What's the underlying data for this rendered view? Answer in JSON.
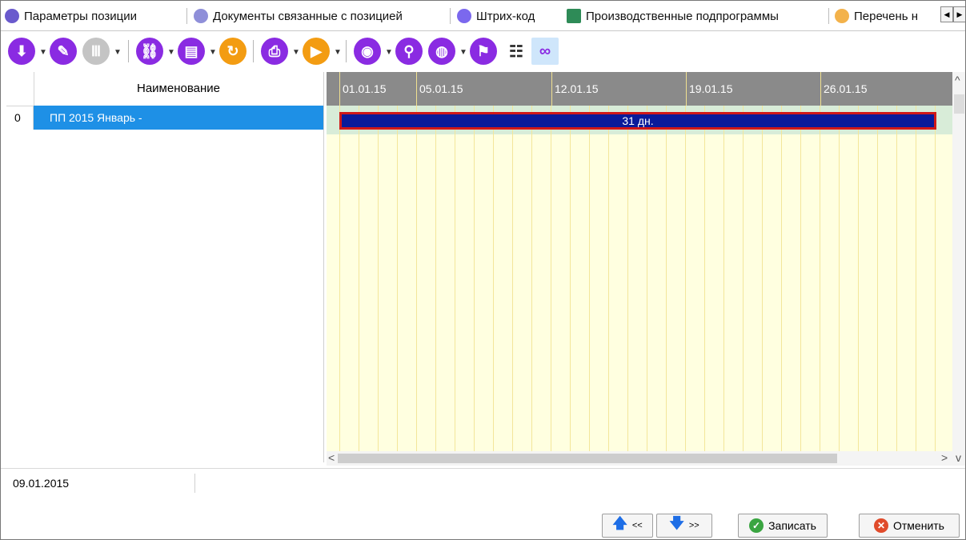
{
  "tabs": [
    {
      "label": "Параметры позиции",
      "icon": "parameters-icon",
      "color": "#6a5acd"
    },
    {
      "label": "Документы связанные с позицией",
      "icon": "documents-icon",
      "color": "#8f8fd9"
    },
    {
      "label": "Штрих-код",
      "icon": "barcode-icon",
      "color": "#7b68ee"
    },
    {
      "label": "Производственные подпрограммы",
      "icon": "grid-table-icon",
      "color": "#2e8b57",
      "active": true
    },
    {
      "label": "Перечень н",
      "icon": "list-icon",
      "color": "#f3b24b"
    }
  ],
  "toolbar": {
    "icons": [
      "download-icon",
      "edit-icon",
      "columns-icon",
      "link-icon",
      "document-icon",
      "refresh-icon",
      "print-icon",
      "play-icon",
      "eye-icon",
      "search-icon",
      "globe-icon",
      "flag-icon",
      "tree-icon",
      "glasses-icon"
    ]
  },
  "grid": {
    "column_header": "Наименование",
    "rows": [
      {
        "num": "0",
        "name": "ПП 2015 Январь -"
      }
    ]
  },
  "gantt": {
    "dates": [
      "01.01.15",
      "05.01.15",
      "12.01.15",
      "19.01.15",
      "26.01.15"
    ],
    "bar_label": "31 дн."
  },
  "status": {
    "current_date": "09.01.2015"
  },
  "footer": {
    "prev_label": "<<",
    "next_label": ">>",
    "save_label": "Записать",
    "cancel_label": "Отменить"
  },
  "colors": {
    "accent": "#1e90e6",
    "toolbar_purple": "#8a2be2",
    "toolbar_orange": "#f39c12",
    "bar": "#0a1a9a",
    "bar_border": "#d01818"
  }
}
